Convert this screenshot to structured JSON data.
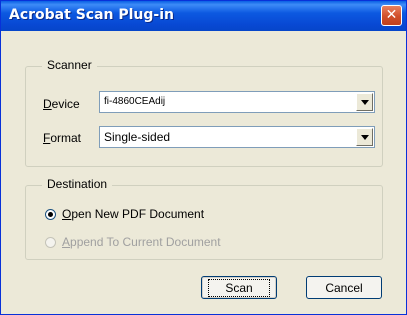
{
  "window": {
    "title": "Acrobat Scan Plug-in",
    "close_glyph": "✕"
  },
  "scanner": {
    "legend": "Scanner",
    "device": {
      "accel": "D",
      "label_rest": "evice",
      "value": "fi-4860CEAdij"
    },
    "format": {
      "accel": "F",
      "label_rest": "ormat",
      "value": "Single-sided"
    }
  },
  "destination": {
    "legend": "Destination",
    "options": [
      {
        "accel": "O",
        "rest": "pen New PDF Document",
        "selected": true,
        "enabled": true
      },
      {
        "accel": "A",
        "rest": "ppend To Current Document",
        "selected": false,
        "enabled": false
      }
    ]
  },
  "buttons": {
    "scan": "Scan",
    "cancel": "Cancel"
  },
  "colors": {
    "titlebar": "#0a5fe4",
    "dialog_bg": "#ece9d8",
    "close": "#d04f2a"
  }
}
